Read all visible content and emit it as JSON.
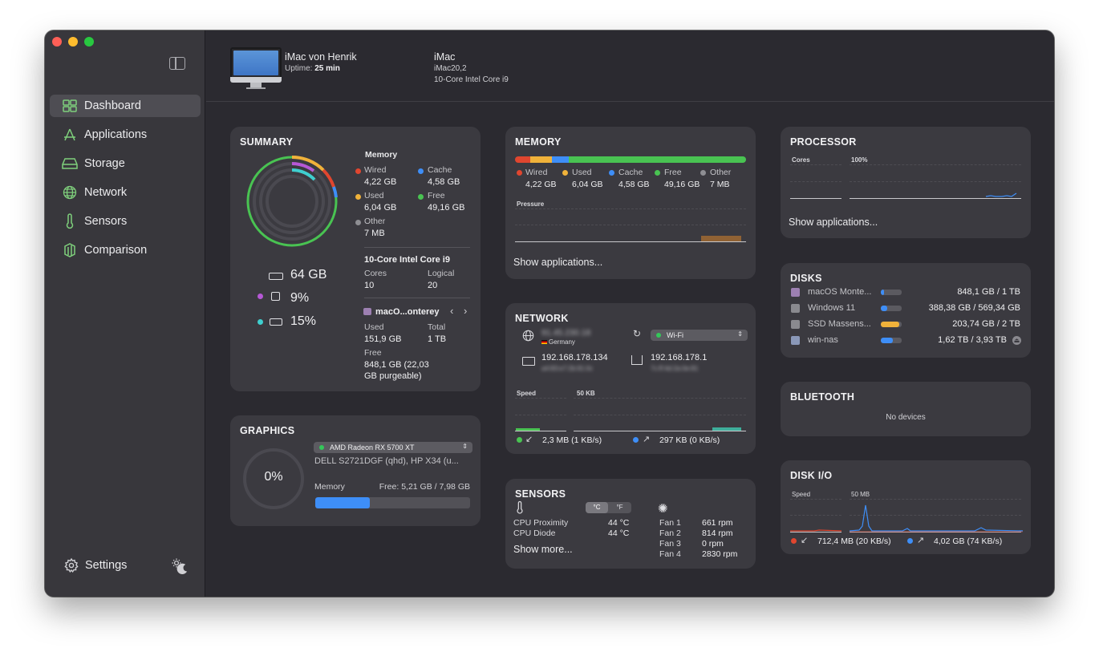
{
  "sidebar": {
    "items": [
      {
        "label": "Dashboard",
        "icon": "dashboard-grid-icon",
        "active": true
      },
      {
        "label": "Applications",
        "icon": "applications-icon"
      },
      {
        "label": "Storage",
        "icon": "storage-drive-icon"
      },
      {
        "label": "Network",
        "icon": "globe-icon"
      },
      {
        "label": "Sensors",
        "icon": "thermometer-icon"
      },
      {
        "label": "Comparison",
        "icon": "comparison-icon"
      }
    ],
    "settings_label": "Settings",
    "accent_color": "#7fd07c"
  },
  "header": {
    "device_name": "iMac von Henrik",
    "uptime_label": "Uptime:",
    "uptime_value": "25 min",
    "model": "iMac",
    "model_id": "iMac20,2",
    "cpu": "10-Core Intel Core i9"
  },
  "summary": {
    "title": "SUMMARY",
    "memory_heading": "Memory",
    "memory": [
      {
        "label": "Wired",
        "value": "4,22 GB",
        "color": "#e0462f"
      },
      {
        "label": "Cache",
        "value": "4,58 GB",
        "color": "#3e8ef7"
      },
      {
        "label": "Used",
        "value": "6,04 GB",
        "color": "#f0b23a"
      },
      {
        "label": "Free",
        "value": "49,16 GB",
        "color": "#49c352"
      },
      {
        "label": "Other",
        "value": "7 MB",
        "color": "#8e8e93"
      }
    ],
    "ram_total": "64 GB",
    "cpu_usage": "9%",
    "disk_usage": "15%",
    "cpu_name": "10-Core Intel Core i9",
    "cores_label": "Cores",
    "cores_value": "10",
    "logical_label": "Logical",
    "logical_value": "20",
    "disk_name": "macO...onterey",
    "used_label": "Used",
    "used_value": "151,9 GB",
    "total_label": "Total",
    "total_value": "1 TB",
    "free_label": "Free",
    "free_value": "848,1 GB (22,03",
    "free_value2": "GB purgeable)"
  },
  "graphics": {
    "title": "GRAPHICS",
    "gpu": "AMD Radeon RX 5700 XT",
    "displays": "DELL S2721DGF (qhd), HP X34 (u...",
    "usage": "0%",
    "memory_label": "Memory",
    "memory_free": "Free: 5,21 GB / 7,98 GB",
    "memory_used_fraction": 0.35
  },
  "memory": {
    "title": "MEMORY",
    "legend": [
      {
        "label": "Wired",
        "value": "4,22 GB",
        "color": "#e0462f"
      },
      {
        "label": "Used",
        "value": "6,04 GB",
        "color": "#f0b23a"
      },
      {
        "label": "Cache",
        "value": "4,58 GB",
        "color": "#3e8ef7"
      },
      {
        "label": "Free",
        "value": "49,16 GB",
        "color": "#49c352"
      },
      {
        "label": "Other",
        "value": "7 MB",
        "color": "#8e8e93"
      }
    ],
    "pressure_label": "Pressure",
    "show_apps": "Show applications..."
  },
  "network": {
    "title": "NETWORK",
    "public_ip": "91.45.230.18",
    "country": "Germany",
    "interface": "Wi-Fi",
    "local_ip": "192.168.178.134",
    "local_mac": "a4:83:e7:2b:91:0c",
    "router_ip": "192.168.178.1",
    "router_mac": "7c:ff:4d:2a:0e:81",
    "speed_label": "Speed",
    "speed_max": "50 KB",
    "download": "2,3 MB (1 KB/s)",
    "upload": "297 KB (0 KB/s)"
  },
  "sensors": {
    "title": "SENSORS",
    "unit_c": "°C",
    "unit_f": "°F",
    "temps": [
      {
        "label": "CPU Proximity",
        "value": "44 °C"
      },
      {
        "label": "CPU Diode",
        "value": "44 °C"
      }
    ],
    "fans": [
      {
        "label": "Fan 1",
        "value": "661 rpm"
      },
      {
        "label": "Fan 2",
        "value": "814 rpm"
      },
      {
        "label": "Fan 3",
        "value": "0 rpm"
      },
      {
        "label": "Fan 4",
        "value": "2830 rpm"
      }
    ],
    "show_more": "Show more..."
  },
  "processor": {
    "title": "PROCESSOR",
    "cores_label": "Cores",
    "scale_label": "100%",
    "show_apps": "Show applications..."
  },
  "disks": {
    "title": "DISKS",
    "items": [
      {
        "name": "macOS Monte...",
        "value": "848,1 GB / 1 TB",
        "fraction": 0.15,
        "color": "#3e8ef7"
      },
      {
        "name": "Windows 11",
        "value": "388,38 GB / 569,34 GB",
        "fraction": 0.32,
        "color": "#3e8ef7"
      },
      {
        "name": "SSD Massens...",
        "value": "203,74 GB / 2 TB",
        "fraction": 0.9,
        "color": "#f0b23a"
      },
      {
        "name": "win-nas",
        "value": "1,62 TB / 3,93 TB",
        "fraction": 0.59,
        "color": "#3e8ef7"
      }
    ]
  },
  "bluetooth": {
    "title": "BLUETOOTH",
    "empty": "No devices"
  },
  "disk_io": {
    "title": "DISK I/O",
    "speed_label": "Speed",
    "scale_label": "50 MB",
    "read": "712,4 MB (20 KB/s)",
    "write": "4,02 GB (74 KB/s)"
  }
}
